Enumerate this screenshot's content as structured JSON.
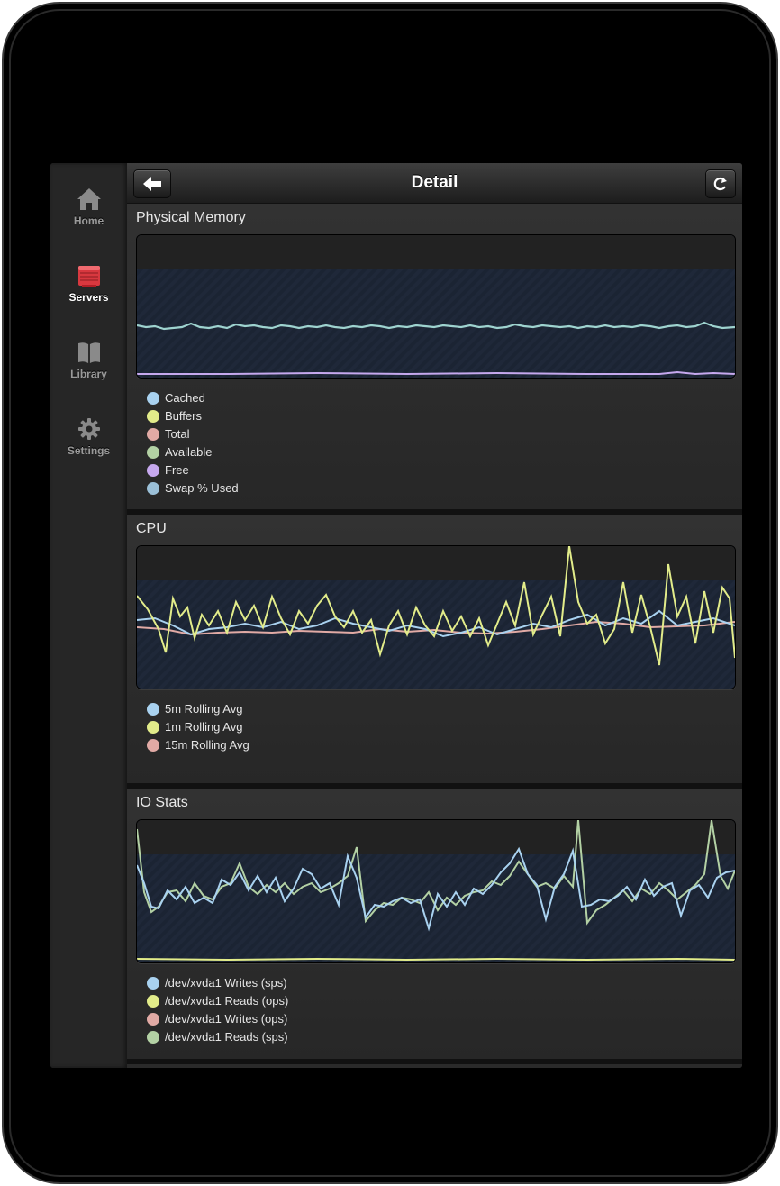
{
  "colors": {
    "blue": "#a9d2f0",
    "yellow": "#e2ec8a",
    "pink": "#e1aaa5",
    "green": "#b3d1a4",
    "purple": "#c6a8ee",
    "steel": "#9bc0d8",
    "teal": "#9ed3cf"
  },
  "nav": {
    "items": [
      {
        "label": "Home",
        "icon": "home-icon"
      },
      {
        "label": "Servers",
        "icon": "servers-icon"
      },
      {
        "label": "Library",
        "icon": "book-icon"
      },
      {
        "label": "Settings",
        "icon": "gear-icon"
      }
    ],
    "active": "Servers"
  },
  "header": {
    "title": "Detail",
    "back_icon": "back-arrow-icon",
    "refresh_icon": "refresh-icon"
  },
  "panels": {
    "memory": {
      "title": "Physical Memory",
      "legend": [
        {
          "label": "Cached",
          "color": "#a9d2f0"
        },
        {
          "label": "Buffers",
          "color": "#e2ec8a"
        },
        {
          "label": "Total",
          "color": "#e1aaa5"
        },
        {
          "label": "Available",
          "color": "#b3d1a4"
        },
        {
          "label": "Free",
          "color": "#c6a8ee"
        },
        {
          "label": "Swap % Used",
          "color": "#9bc0d8"
        }
      ]
    },
    "cpu": {
      "title": "CPU",
      "legend": [
        {
          "label": "5m Rolling Avg",
          "color": "#a9d2f0"
        },
        {
          "label": "1m Rolling Avg",
          "color": "#e2ec8a"
        },
        {
          "label": "15m Rolling Avg",
          "color": "#e1aaa5"
        }
      ]
    },
    "io": {
      "title": "IO Stats",
      "legend": [
        {
          "label": "/dev/xvda1 Writes (sps)",
          "color": "#a9d2f0"
        },
        {
          "label": "/dev/xvda1 Reads (ops)",
          "color": "#e2ec8a"
        },
        {
          "label": "/dev/xvda1 Writes (ops)",
          "color": "#e1aaa5"
        },
        {
          "label": "/dev/xvda1 Reads (sps)",
          "color": "#b3d1a4"
        }
      ]
    }
  }
}
